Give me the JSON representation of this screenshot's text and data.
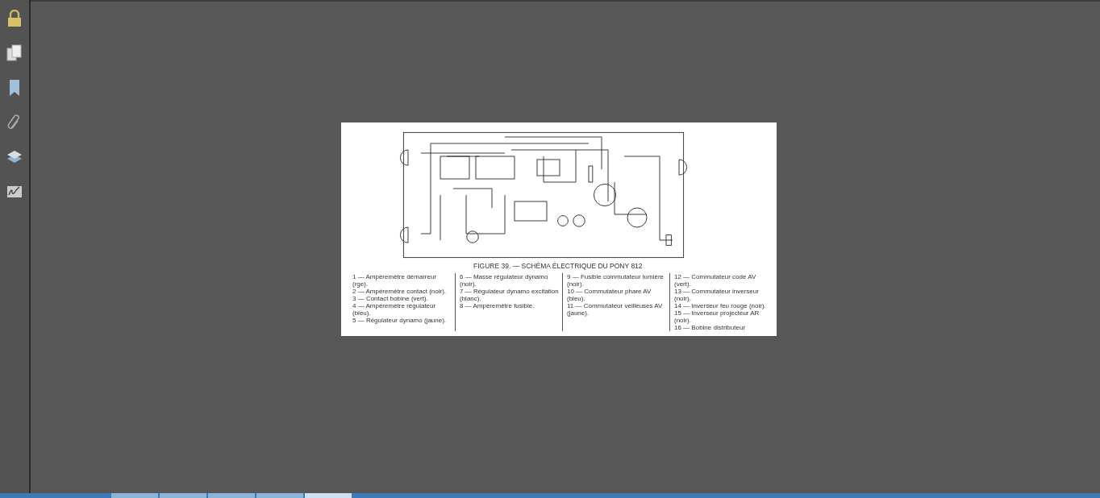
{
  "document": {
    "caption": "FIGURE 39. — SCHÉMA ÉLECTRIQUE DU PONY 812",
    "legend_columns": [
      [
        "1 — Ampèremètre démarreur (rge).",
        "2 — Ampèremètre contact (noir).",
        "3 — Contact bobine (vert).",
        "4 — Ampèremètre régulateur (bleu).",
        "5 — Régulateur dynamo (jaune)."
      ],
      [
        "6 — Masse régulateur dynamo (noir).",
        "7 — Régulateur dynamo excitation (blanc).",
        "8 — Ampèremètre fusible."
      ],
      [
        "9 — Fusible commutateur lumière (noir).",
        "10 — Commutateur phare AV (bleu).",
        "11 — Commutateur veilleuses AV (jaune)."
      ],
      [
        "12 — Commutateur code AV (vert).",
        "13 — Commutateur inverseur (noir).",
        "14 — Inverseur feu rouge (noir).",
        "15 — Inverseur projecteur AR (noir).",
        "16 — Bobine distributeur"
      ]
    ]
  }
}
